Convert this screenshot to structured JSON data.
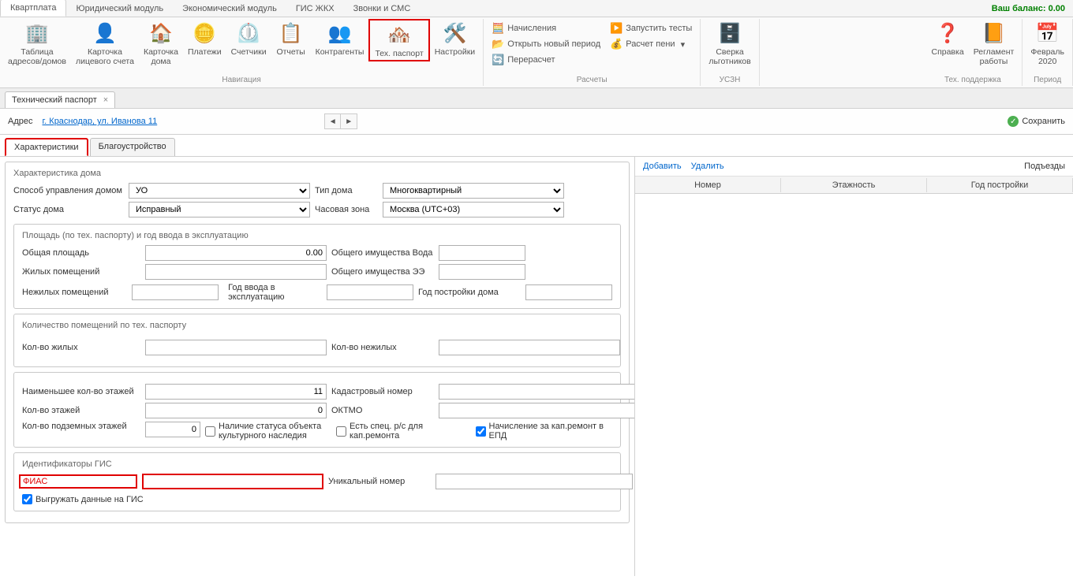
{
  "balance": "Ваш баланс: 0.00",
  "ribbonTabs": {
    "active": "Квартплата",
    "t1": "Квартплата",
    "t2": "Юридический модуль",
    "t3": "Экономический модуль",
    "t4": "ГИС ЖКХ",
    "t5": "Звонки и СМС"
  },
  "ribbon": {
    "nav": {
      "tableAddr": "Таблица\nадресов/домов",
      "personalCard": "Карточка\nлицевого счета",
      "houseCard": "Карточка\nдома",
      "payments": "Платежи",
      "counters": "Счетчики",
      "reports": "Отчеты",
      "contragents": "Контрагенты",
      "techPassport": "Тех. паспорт",
      "settings": "Настройки",
      "groupLabel": "Навигация"
    },
    "calc": {
      "accruals": "Начисления",
      "openPeriod": "Открыть новый период",
      "recalc": "Перерасчет",
      "runTests": "Запустить тесты",
      "penalty": "Расчет пени",
      "groupLabel": "Расчеты"
    },
    "uszn": {
      "label": "Сверка\nльготников",
      "groupLabel": "УСЗН"
    },
    "help": {
      "help": "Справка",
      "regulation": "Регламент\nработы",
      "groupLabel": "Тех. поддержка"
    },
    "period": {
      "label": "Февраль\n2020",
      "groupLabel": "Период"
    }
  },
  "docTab": {
    "title": "Технический паспорт"
  },
  "addressBar": {
    "label": "Адрес",
    "link": "г. Краснодар, ул. Иванова 11",
    "save": "Сохранить"
  },
  "subTabs": {
    "t1": "Характеристики",
    "t2": "Благоустройство"
  },
  "form": {
    "fsetMain": "Характеристика дома",
    "manageMethod": {
      "label": "Способ управления домом",
      "value": "УО"
    },
    "houseType": {
      "label": "Тип дома",
      "value": "Многоквартирный"
    },
    "houseStatus": {
      "label": "Статус дома",
      "value": "Исправный"
    },
    "timezone": {
      "label": "Часовая зона",
      "value": "Москва (UTC+03)"
    },
    "fsetArea": "Площадь (по тех. паспорту) и год ввода в эксплуатацию",
    "area": {
      "total": "Общая площадь",
      "totalVal": "0.00",
      "living": "Жилых помещений",
      "nonLiving": "Нежилых помещений",
      "commonWater": "Общего имущества Вода",
      "commonEE": "Общего имущества ЭЭ",
      "yearCommission": "Год ввода в эксплуатацию",
      "yearBuild": "Год постройки дома"
    },
    "fsetCount": "Количество помещений по тех. паспорту",
    "count": {
      "living": "Кол-во жилых",
      "nonLiving": "Кол-во нежилых"
    },
    "floors": {
      "minFloors": "Наименьшее кол-во этажей",
      "minFloorsVal": "11",
      "floors": "Кол-во этажей",
      "floorsVal": "0",
      "underground": "Кол-во подземных этажей",
      "undergroundVal": "0",
      "heritage": "Наличие статуса объекта культурного наследия",
      "cadastral": "Кадастровый номер",
      "oktmo": "ОКТМО",
      "specAccount": "Есть спец. р/с для кап.ремонта",
      "capitalRepair": "Начисление за кап.ремонт в ЕПД"
    },
    "fsetGis": "Идентификаторы ГИС",
    "gis": {
      "fias": "ФИАС",
      "unique": "Уникальный номер",
      "export": "Выгружать данные на ГИС"
    }
  },
  "rightPanel": {
    "add": "Добавить",
    "del": "Удалить",
    "title": "Подъезды",
    "colNumber": "Номер",
    "colFloors": "Этажность",
    "colYear": "Год постройки"
  }
}
